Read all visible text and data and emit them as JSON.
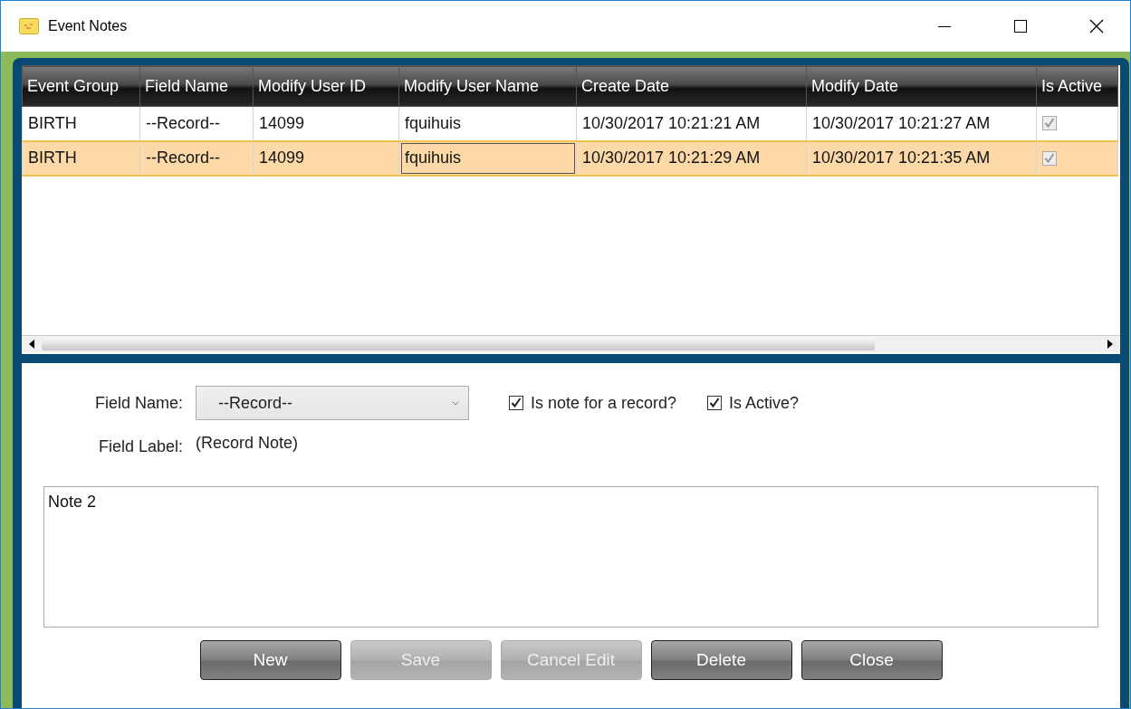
{
  "window": {
    "title": "Event Notes"
  },
  "table": {
    "columns": [
      "Event Group",
      "Field Name",
      "Modify User ID",
      "Modify User Name",
      "Create Date",
      "Modify Date",
      "Is Active"
    ],
    "rows": [
      {
        "cells": [
          "BIRTH",
          "--Record--",
          "14099",
          "fquihuis",
          "10/30/2017 10:21:21 AM",
          "10/30/2017 10:21:27 AM"
        ],
        "is_active": true,
        "selected": false
      },
      {
        "cells": [
          "BIRTH",
          "--Record--",
          "14099",
          "fquihuis",
          "10/30/2017 10:21:29 AM",
          "10/30/2017 10:21:35 AM"
        ],
        "is_active": true,
        "selected": true
      }
    ]
  },
  "form": {
    "field_name_label": "Field Name:",
    "field_name_value": "--Record--",
    "checkboxes": [
      {
        "label": "Is note for a record?",
        "checked": true
      },
      {
        "label": "Is Active?",
        "checked": true
      }
    ],
    "field_label_label": "Field Label:",
    "field_label_value": "(Record Note)",
    "note": "Note 2"
  },
  "buttons": [
    {
      "label": "New",
      "disabled": false
    },
    {
      "label": "Save",
      "disabled": true
    },
    {
      "label": "Cancel Edit",
      "disabled": true
    },
    {
      "label": "Delete",
      "disabled": false
    },
    {
      "label": "Close",
      "disabled": false
    }
  ]
}
